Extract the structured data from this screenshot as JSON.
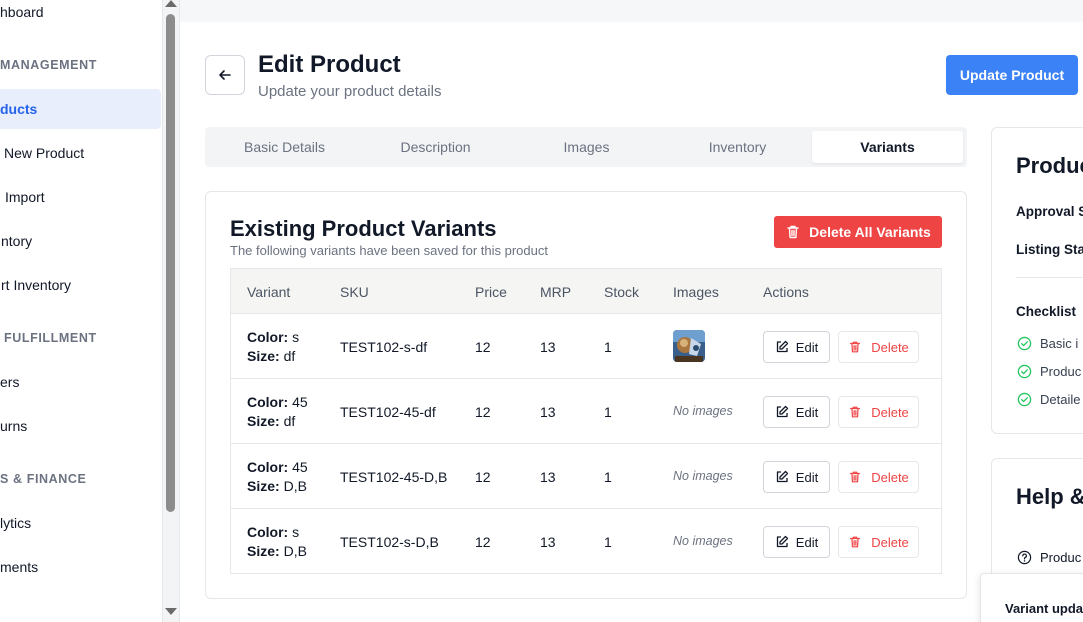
{
  "sidebar": {
    "items": [
      {
        "label": "hboard"
      },
      {
        "label": "ducts"
      },
      {
        "label": "New Product"
      },
      {
        "label": "Import"
      },
      {
        "label": "ntory"
      },
      {
        "label": "rt Inventory"
      },
      {
        "label": "ers"
      },
      {
        "label": "urns"
      },
      {
        "label": "lytics"
      },
      {
        "label": "ments"
      }
    ],
    "sections": [
      "MANAGEMENT",
      "FULFILLMENT",
      "S & FINANCE"
    ]
  },
  "header": {
    "title": "Edit Product",
    "subtitle": "Update your product details",
    "update_label": "Update Product"
  },
  "tabs": [
    {
      "label": "Basic Details"
    },
    {
      "label": "Description"
    },
    {
      "label": "Images"
    },
    {
      "label": "Inventory"
    },
    {
      "label": "Variants"
    }
  ],
  "variants_card": {
    "title": "Existing Product Variants",
    "subtitle": "The following variants have been saved for this product",
    "delete_all_label": "Delete All Variants",
    "columns": [
      "Variant",
      "SKU",
      "Price",
      "MRP",
      "Stock",
      "Images",
      "Actions"
    ],
    "rows": [
      {
        "color_label": "Color:",
        "color": "s",
        "size_label": "Size:",
        "size": "df",
        "sku": "TEST102-s-df",
        "price": "12",
        "mrp": "13",
        "stock": "1",
        "images": null,
        "edit": "Edit",
        "delete": "Delete"
      },
      {
        "color_label": "Color:",
        "color": "45",
        "size_label": "Size:",
        "size": "df",
        "sku": "TEST102-45-df",
        "price": "12",
        "mrp": "13",
        "stock": "1",
        "images": "No images",
        "edit": "Edit",
        "delete": "Delete"
      },
      {
        "color_label": "Color:",
        "color": "45",
        "size_label": "Size:",
        "size": "D,B",
        "sku": "TEST102-45-D,B",
        "price": "12",
        "mrp": "13",
        "stock": "1",
        "images": "No images",
        "edit": "Edit",
        "delete": "Delete"
      },
      {
        "color_label": "Color:",
        "color": "s",
        "size_label": "Size:",
        "size": "D,B",
        "sku": "TEST102-s-D,B",
        "price": "12",
        "mrp": "13",
        "stock": "1",
        "images": "No images",
        "edit": "Edit",
        "delete": "Delete"
      }
    ]
  },
  "status_panel": {
    "title": "Produc",
    "approval_label": "Approval S",
    "listing_label": "Listing Stat",
    "checklist_title": "Checklist",
    "checklist": [
      "Basic i",
      "Produc",
      "Detaile"
    ]
  },
  "help_panel": {
    "title": "Help &",
    "item": "Produc"
  },
  "toast": {
    "text": "Variant upda"
  },
  "colors": {
    "primary": "#3b82f6",
    "danger": "#ef4444",
    "success": "#22c55e",
    "active_bg": "#e8eefc"
  }
}
